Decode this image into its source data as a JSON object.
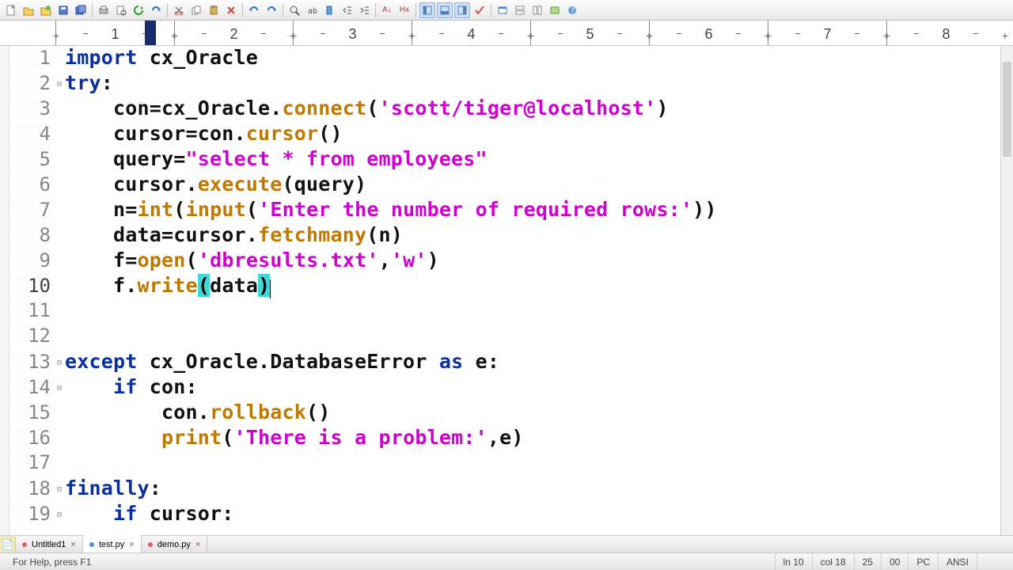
{
  "toolbar_icons": [
    "new-icon",
    "open-icon",
    "reopen-icon",
    "save-icon",
    "save-all-icon",
    "print-icon",
    "print-preview-icon",
    "refresh-icon",
    "redo-arrow-icon",
    "cut-icon",
    "copy-icon",
    "paste-icon",
    "delete-icon",
    "close-icon",
    "undo-icon",
    "redo-icon",
    "find-icon",
    "find-text-icon",
    "bookmark-icon",
    "indent-icon",
    "outdent-icon",
    "html-tag-icon",
    "hx-icon",
    "toggle-panel-1-icon",
    "toggle-panel-2-icon",
    "toggle-panel-3-icon",
    "check-icon",
    "window-icon",
    "split-h-icon",
    "split-v-icon",
    "new-window-icon",
    "help-icon"
  ],
  "ruler": {
    "start": 1,
    "end": 8,
    "cursor_col": 1.8
  },
  "code": {
    "lines": [
      {
        "n": 1,
        "indent": 0,
        "fold": "",
        "tokens": [
          [
            "kw",
            "import"
          ],
          [
            "plain",
            " cx_Oracle"
          ]
        ]
      },
      {
        "n": 2,
        "indent": 0,
        "fold": "⊟",
        "tokens": [
          [
            "kw",
            "try"
          ],
          [
            "plain",
            ":"
          ]
        ]
      },
      {
        "n": 3,
        "indent": 1,
        "tokens": [
          [
            "plain",
            "con=cx_Oracle."
          ],
          [
            "call",
            "connect"
          ],
          [
            "plain",
            "("
          ],
          [
            "str",
            "'scott/tiger@localhost'"
          ],
          [
            "plain",
            ")"
          ]
        ]
      },
      {
        "n": 4,
        "indent": 1,
        "tokens": [
          [
            "plain",
            "cursor=con."
          ],
          [
            "call",
            "cursor"
          ],
          [
            "plain",
            "()"
          ]
        ]
      },
      {
        "n": 5,
        "indent": 1,
        "tokens": [
          [
            "plain",
            "query="
          ],
          [
            "str",
            "\"select * from employees\""
          ]
        ]
      },
      {
        "n": 6,
        "indent": 1,
        "tokens": [
          [
            "plain",
            "cursor."
          ],
          [
            "call",
            "execute"
          ],
          [
            "plain",
            "(query)"
          ]
        ]
      },
      {
        "n": 7,
        "indent": 1,
        "tokens": [
          [
            "plain",
            "n="
          ],
          [
            "call",
            "int"
          ],
          [
            "plain",
            "("
          ],
          [
            "call",
            "input"
          ],
          [
            "plain",
            "("
          ],
          [
            "str",
            "'Enter the number of required rows:'"
          ],
          [
            "plain",
            "))"
          ]
        ]
      },
      {
        "n": 8,
        "indent": 1,
        "tokens": [
          [
            "plain",
            "data=cursor."
          ],
          [
            "call",
            "fetchmany"
          ],
          [
            "plain",
            "(n)"
          ]
        ]
      },
      {
        "n": 9,
        "indent": 1,
        "tokens": [
          [
            "plain",
            "f="
          ],
          [
            "call",
            "open"
          ],
          [
            "plain",
            "("
          ],
          [
            "str",
            "'dbresults.txt'"
          ],
          [
            "plain",
            ","
          ],
          [
            "str",
            "'w'"
          ],
          [
            "plain",
            ")"
          ]
        ]
      },
      {
        "n": 10,
        "indent": 1,
        "current": true,
        "tokens": [
          [
            "plain",
            "f."
          ],
          [
            "call",
            "write"
          ],
          [
            "brmatch",
            "("
          ],
          [
            "plain",
            "data"
          ],
          [
            "brmatch",
            ")"
          ]
        ]
      },
      {
        "n": 11,
        "indent": 0,
        "tokens": []
      },
      {
        "n": 12,
        "indent": 0,
        "tokens": []
      },
      {
        "n": 13,
        "indent": 0,
        "fold": "⊟",
        "tokens": [
          [
            "kw",
            "except"
          ],
          [
            "plain",
            " cx_Oracle.DatabaseError "
          ],
          [
            "kw",
            "as"
          ],
          [
            "plain",
            " e:"
          ]
        ]
      },
      {
        "n": 14,
        "indent": 1,
        "fold": "⊟",
        "tokens": [
          [
            "kw",
            "if"
          ],
          [
            "plain",
            " con:"
          ]
        ]
      },
      {
        "n": 15,
        "indent": 2,
        "tokens": [
          [
            "plain",
            "con."
          ],
          [
            "call",
            "rollback"
          ],
          [
            "plain",
            "()"
          ]
        ]
      },
      {
        "n": 16,
        "indent": 2,
        "tokens": [
          [
            "call",
            "print"
          ],
          [
            "plain",
            "("
          ],
          [
            "str",
            "'There is a problem:'"
          ],
          [
            "plain",
            ",e)"
          ]
        ]
      },
      {
        "n": 17,
        "indent": 0,
        "tokens": []
      },
      {
        "n": 18,
        "indent": 0,
        "fold": "⊟",
        "tokens": [
          [
            "kw",
            "finally"
          ],
          [
            "plain",
            ":"
          ]
        ]
      },
      {
        "n": 19,
        "indent": 1,
        "fold": "⊟",
        "tokens": [
          [
            "kw",
            "if"
          ],
          [
            "plain",
            " cursor:"
          ]
        ]
      }
    ]
  },
  "tabs": [
    {
      "label": "Untitled1",
      "active": false
    },
    {
      "label": "test.py",
      "active": true
    },
    {
      "label": "demo.py",
      "active": false
    }
  ],
  "status": {
    "hint": "For Help, press F1",
    "ln": "ln 10",
    "col": "col 18",
    "a": "25",
    "b": "00",
    "mode": "PC",
    "enc": "ANSI"
  }
}
